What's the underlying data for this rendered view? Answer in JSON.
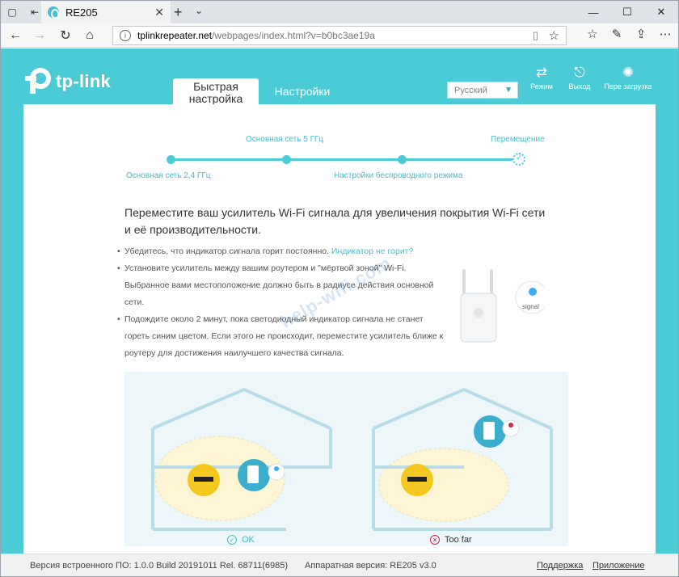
{
  "browser": {
    "tab_title": "RE205",
    "url_host": "tplinkrepeater.net",
    "url_path": "/webpages/index.html?v=b0bc3ae19a"
  },
  "header": {
    "logo_text": "tp-link",
    "tabs": [
      {
        "label_line1": "Быстрая",
        "label_line2": "настройка"
      },
      {
        "label": "Настройки"
      }
    ],
    "language": "Русский",
    "buttons": [
      {
        "label": "Режим",
        "icon": "mode-icon"
      },
      {
        "label": "Выход",
        "icon": "logout-icon"
      },
      {
        "label": "Пере загрузка",
        "icon": "reboot-icon"
      }
    ]
  },
  "progress": {
    "top_labels": [
      "Основная сеть 5 ГГц",
      "Перемещение"
    ],
    "bottom_labels": [
      "Основная сеть 2,4 ГГц",
      "Настройки беспроводного режима"
    ]
  },
  "main": {
    "heading": "Переместите ваш усилитель Wi-Fi сигнала для увеличения покрытия Wi-Fi сети и её производительности.",
    "bullet1_text": "Убедитесь, что индикатор сигнала горит постоянно.",
    "bullet1_link": "Индикатор не горит?",
    "bullet2_text": "Установите усилитель между вашим роутером и \"мёртвой зоной\" Wi-Fi. Выбранное вами местоположение должно быть в радиусе действия основной сети.",
    "bullet3_text": "Подождите около 2 минут, пока светодиодный индикатор сигнала не станет гореть синим цветом. Если этого не происходит, переместите усилитель ближе к роутеру для достижения наилучшего качества сигнала.",
    "signal_label": "signal",
    "watermark": "help-wifi.com",
    "status_ok": "OK",
    "status_bad": "Too far"
  },
  "footer": {
    "firmware": "Версия встроенного ПО: 1.0.0 Build 20191011 Rel. 68711(6985)",
    "hardware": "Аппаратная версия: RE205 v3.0",
    "support": "Поддержка",
    "app": "Приложение"
  },
  "colors": {
    "accent": "#4acbd6",
    "link": "#4abccb",
    "error": "#c7264f"
  }
}
